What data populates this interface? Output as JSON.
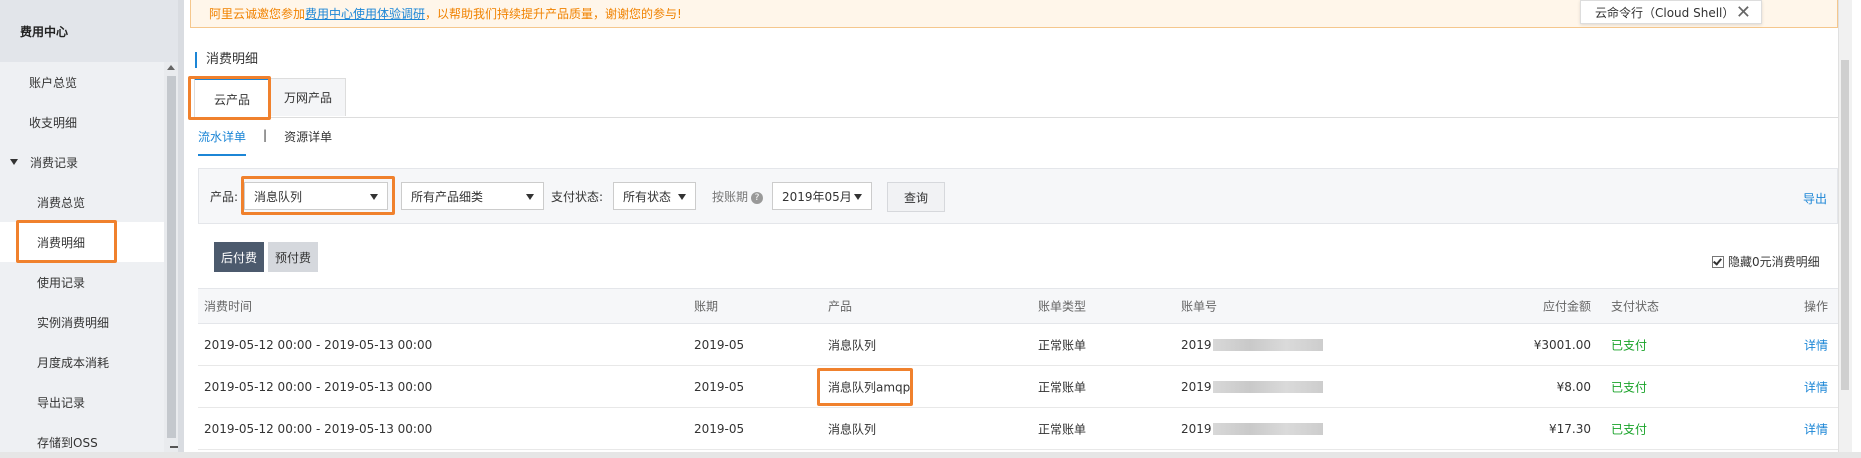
{
  "sidebar": {
    "title": "费用中心",
    "items": [
      {
        "label": "账户总览",
        "kind": "item"
      },
      {
        "label": "收支明细",
        "kind": "item"
      },
      {
        "label": "消费记录",
        "kind": "group"
      },
      {
        "label": "消费总览",
        "kind": "sub"
      },
      {
        "label": "消费明细",
        "kind": "sub"
      },
      {
        "label": "使用记录",
        "kind": "sub"
      },
      {
        "label": "实例消费明细",
        "kind": "sub"
      },
      {
        "label": "月度成本消耗",
        "kind": "sub"
      },
      {
        "label": "导出记录",
        "kind": "sub"
      },
      {
        "label": "存储到OSS",
        "kind": "sub"
      }
    ]
  },
  "banner": {
    "prefix": "阿里云诚邀您参加",
    "link": "费用中心使用体验调研",
    "suffix": "，以帮助我们持续提升产品质量，谢谢您的参与!"
  },
  "cloud_shell": {
    "label": "云命令行（Cloud Shell）",
    "close": "✕"
  },
  "page_title": "消费明细",
  "tabs": [
    {
      "label": "云产品"
    },
    {
      "label": "万网产品"
    }
  ],
  "subtabs": {
    "flow": "流水详单",
    "separator": "|",
    "resource": "资源详单"
  },
  "filter": {
    "product_label": "产品:",
    "product_value": "消息队列",
    "category_value": "所有产品细类",
    "pay_status_label": "支付状态:",
    "pay_status_value": "所有状态",
    "period_label": "按账期",
    "period_help": "?",
    "period_value": "2019年05月",
    "query_button": "查询",
    "export": "导出"
  },
  "pay_buttons": {
    "postpaid": "后付费",
    "prepaid": "预付费"
  },
  "hide_zero": {
    "label": "隐藏0元消费明细",
    "checked": true
  },
  "table": {
    "headers": {
      "time": "消费时间",
      "period": "账期",
      "product": "产品",
      "type": "账单类型",
      "bill_no": "账单号",
      "amount": "应付金额",
      "status": "支付状态",
      "action": "操作"
    },
    "rows": [
      {
        "time": "2019-05-12 00:00 - 2019-05-13 00:00",
        "period": "2019-05",
        "product": "消息队列",
        "type": "正常账单",
        "bill_no": "2019",
        "amount": "¥3001.00",
        "status": "已支付",
        "action": "详情"
      },
      {
        "time": "2019-05-12 00:00 - 2019-05-13 00:00",
        "period": "2019-05",
        "product": "消息队列amqp",
        "type": "正常账单",
        "bill_no": "2019",
        "amount": "¥8.00",
        "status": "已支付",
        "action": "详情"
      },
      {
        "time": "2019-05-12 00:00 - 2019-05-13 00:00",
        "period": "2019-05",
        "product": "消息队列",
        "type": "正常账单",
        "bill_no": "2019",
        "amount": "¥17.30",
        "status": "已支付",
        "action": "详情"
      }
    ]
  },
  "colors": {
    "accent": "#1c86d6",
    "highlight": "#f0812d",
    "paid": "#1aa32a",
    "warning_text": "#f08200"
  }
}
